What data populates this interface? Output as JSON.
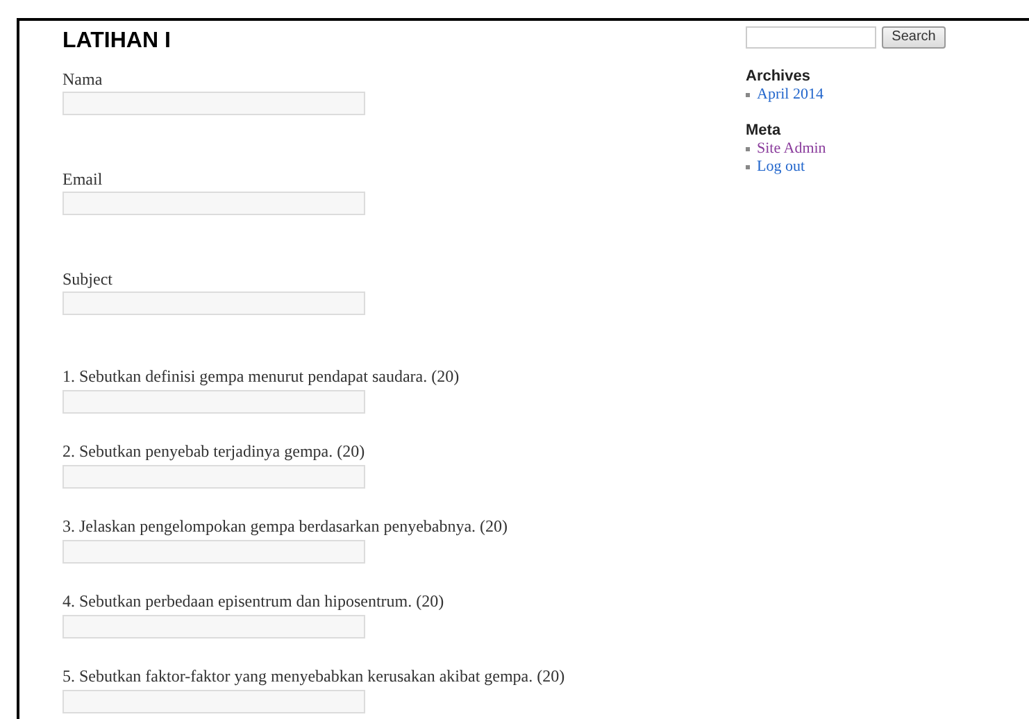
{
  "page": {
    "title": "LATIHAN I"
  },
  "contact_fields": [
    {
      "label": "Nama"
    },
    {
      "label": "Email"
    },
    {
      "label": "Subject"
    }
  ],
  "questions": [
    {
      "label": "1. Sebutkan definisi gempa menurut pendapat saudara. (20)"
    },
    {
      "label": "2. Sebutkan penyebab terjadinya gempa. (20)"
    },
    {
      "label": "3. Jelaskan pengelompokan gempa berdasarkan penyebabnya. (20)"
    },
    {
      "label": "4. Sebutkan perbedaan episentrum dan hiposentrum. (20)"
    },
    {
      "label": "5. Sebutkan faktor-faktor yang menyebabkan kerusakan akibat gempa. (20)"
    }
  ],
  "sidebar": {
    "search_button": "Search",
    "sections": [
      {
        "heading": "Archives",
        "links": [
          {
            "label": "April 2014",
            "visited": false
          }
        ]
      },
      {
        "heading": "Meta",
        "links": [
          {
            "label": "Site Admin",
            "visited": true
          },
          {
            "label": "Log out",
            "visited": false
          }
        ]
      }
    ]
  }
}
